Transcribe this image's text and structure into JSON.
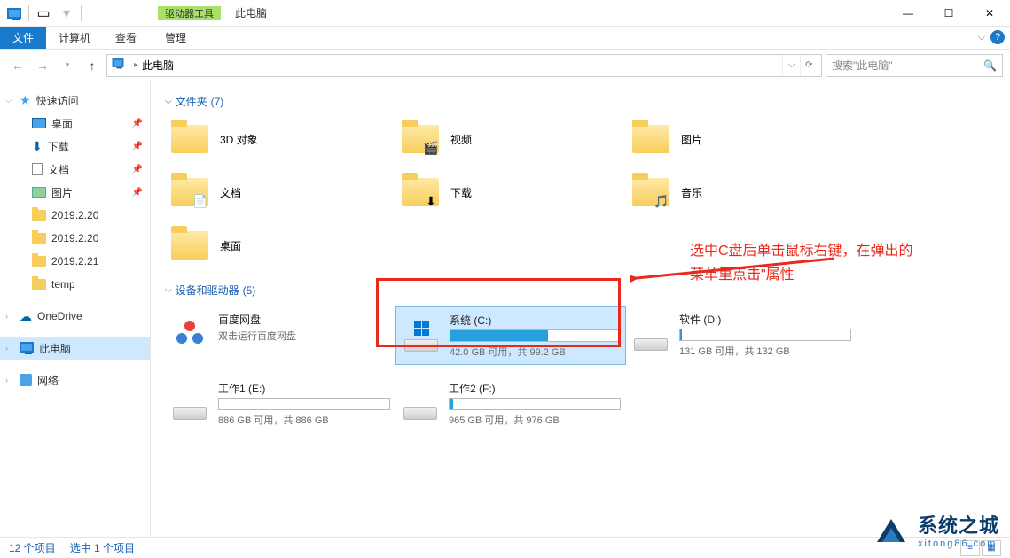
{
  "window": {
    "contextual_tab_group": "驱动器工具",
    "title": "此电脑",
    "controls": {
      "min": "—",
      "max": "☐",
      "close": "✕"
    }
  },
  "ribbon": {
    "file": "文件",
    "tabs": [
      "计算机",
      "查看"
    ],
    "context_tab": "管理"
  },
  "nav": {
    "breadcrumb_root": "此电脑",
    "search_placeholder": "搜索\"此电脑\""
  },
  "sidebar": {
    "quick": "快速访问",
    "quick_items": [
      {
        "label": "桌面",
        "icon": "desktop",
        "pinned": true
      },
      {
        "label": "下载",
        "icon": "dl",
        "pinned": true
      },
      {
        "label": "文档",
        "icon": "doc",
        "pinned": true
      },
      {
        "label": "图片",
        "icon": "pic",
        "pinned": true
      },
      {
        "label": "2019.2.20",
        "icon": "folder",
        "pinned": false
      },
      {
        "label": "2019.2.20",
        "icon": "folder",
        "pinned": false
      },
      {
        "label": "2019.2.21",
        "icon": "folder",
        "pinned": false
      },
      {
        "label": "temp",
        "icon": "folder",
        "pinned": false
      }
    ],
    "onedrive": "OneDrive",
    "thispc": "此电脑",
    "network": "网络"
  },
  "groups": {
    "folders": {
      "label": "文件夹",
      "count": "(7)"
    },
    "drives": {
      "label": "设备和驱动器",
      "count": "(5)"
    }
  },
  "folders": [
    {
      "name": "3D 对象",
      "badge": ""
    },
    {
      "name": "视频",
      "badge": "🎬"
    },
    {
      "name": "图片",
      "badge": ""
    },
    {
      "name": "文档",
      "badge": "📄"
    },
    {
      "name": "下载",
      "badge": "⬇"
    },
    {
      "name": "音乐",
      "badge": "🎵"
    },
    {
      "name": "桌面",
      "badge": ""
    }
  ],
  "drives": [
    {
      "name": "百度网盘",
      "sub": "双击运行百度网盘",
      "type": "app",
      "fill": 0
    },
    {
      "name": "系统 (C:)",
      "sub": "42.0 GB 可用，共 99.2 GB",
      "type": "os",
      "fill": 58,
      "selected": true
    },
    {
      "name": "软件 (D:)",
      "sub": "131 GB 可用，共 132 GB",
      "type": "hdd",
      "fill": 1
    },
    {
      "name": "工作1 (E:)",
      "sub": "886 GB 可用，共 886 GB",
      "type": "hdd",
      "fill": 0
    },
    {
      "name": "工作2 (F:)",
      "sub": "965 GB 可用，共 976 GB",
      "type": "hdd",
      "fill": 2
    }
  ],
  "annotation": {
    "line1": "选中C盘后单击鼠标右键，在弹出的",
    "line2": "菜单里点击\"属性"
  },
  "status": {
    "count": "12 个项目",
    "selected": "选中 1 个项目"
  },
  "watermark": {
    "main": "系统之城",
    "sub": "xitong86.com"
  }
}
